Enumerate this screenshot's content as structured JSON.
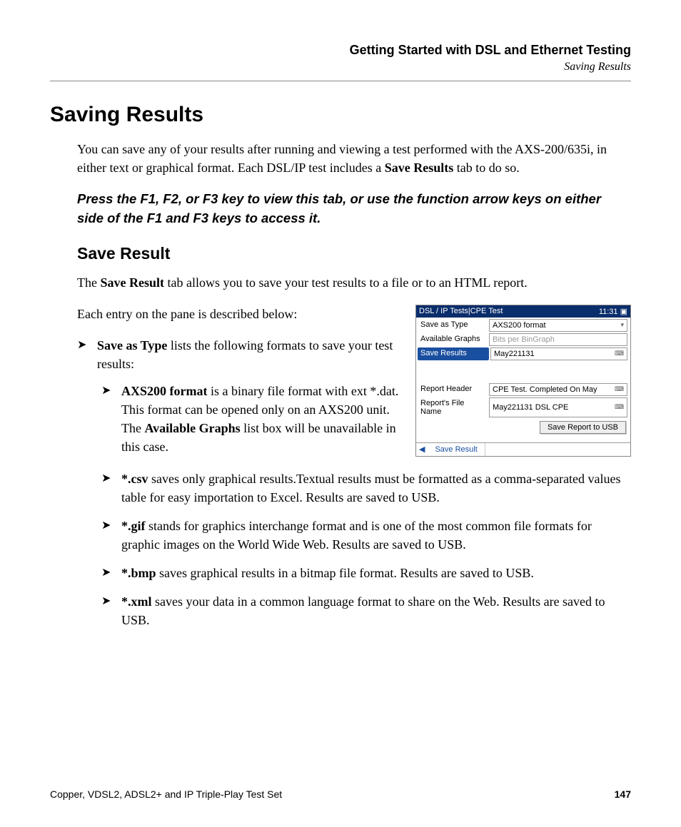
{
  "header": {
    "chapter": "Getting Started with DSL and Ethernet Testing",
    "breadcrumb": "Saving Results"
  },
  "section": {
    "title": "Saving Results",
    "intro_pre": "You can save any of your results after running and viewing a test performed with the AXS-200/635i, in either text or graphical format. Each DSL/IP test includes a ",
    "intro_bold": "Save Results",
    "intro_post": " tab to do so.",
    "note": "Press the F1, F2, or F3 key to view this tab, or use the function arrow keys on either side of the F1 and F3 keys to access it."
  },
  "subsection": {
    "title": "Save Result",
    "p1_pre": "The ",
    "p1_bold": "Save Result",
    "p1_post": " tab allows you to save your test results to a file or to an HTML report.",
    "p2": "Each entry on the pane is described below:"
  },
  "list": {
    "l1_bold": "Save as Type",
    "l1_post": " lists the following formats to save your test results:",
    "l1a_bold": "AXS200 format",
    "l1a_mid": " is a binary file format with ext  *.dat. This format can be opened only on an AXS200 unit. The ",
    "l1a_bold2": "Available Graphs",
    "l1a_post": " list box will be unavailable in this case.",
    "l1b_bold": "*.csv",
    "l1b_post": " saves only graphical results.Textual results must be formatted as a comma-separated values table for easy importation to Excel. Results are saved to USB.",
    "l1c_bold": "*.gif",
    "l1c_post": " stands for graphics interchange format and is one of the most common file formats for graphic images on the World Wide Web. Results are saved to USB.",
    "l1d_bold": "*.bmp",
    "l1d_post": " saves graphical results in a bitmap file format. Results are saved to USB.",
    "l1e_bold": "*.xml",
    "l1e_post": " saves your data in a common language format to share on the Web. Results are saved to USB."
  },
  "screenshot": {
    "title": "DSL / IP Tests|CPE Test",
    "clock": "11:31",
    "rows": {
      "save_as_type_label": "Save as Type",
      "save_as_type_value": "AXS200 format",
      "available_graphs_label": "Available Graphs",
      "available_graphs_value": "Bits per BinGraph",
      "save_results_label": "Save Results",
      "save_results_value": "May221131",
      "report_header_label": "Report Header",
      "report_header_value": "CPE Test. Completed On May",
      "report_file_label": "Report's File Name",
      "report_file_value": "May221131 DSL CPE"
    },
    "button": "Save Report to USB",
    "tab": "Save Result"
  },
  "footer": {
    "left": "Copper, VDSL2, ADSL2+ and IP Triple-Play Test Set",
    "page": "147"
  }
}
